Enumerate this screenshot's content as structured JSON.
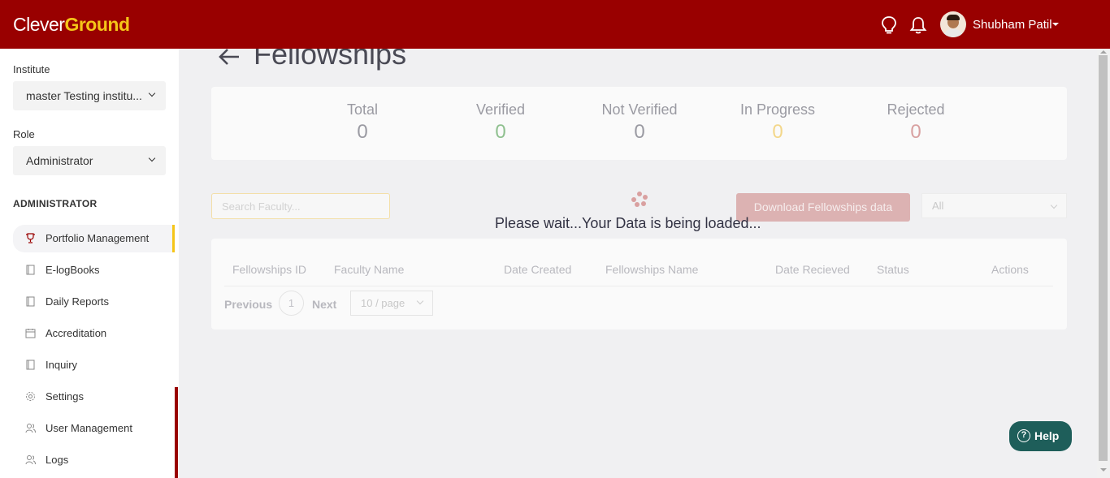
{
  "header": {
    "logo_part1": "Clever",
    "logo_part2": "Ground",
    "user_name": "Shubham Patil",
    "icons": [
      "lightbulb-icon",
      "bell-icon"
    ]
  },
  "sidebar": {
    "institute_label": "Institute",
    "institute_value": "master Testing institu...",
    "role_label": "Role",
    "role_value": "Administrator",
    "section_title": "ADMINISTRATOR",
    "items": [
      {
        "label": "Portfolio Management",
        "icon": "trophy-icon",
        "active": true
      },
      {
        "label": "E-logBooks",
        "icon": "book-icon"
      },
      {
        "label": "Daily Reports",
        "icon": "book-icon"
      },
      {
        "label": "Accreditation",
        "icon": "calendar-icon"
      },
      {
        "label": "Inquiry",
        "icon": "book-icon"
      },
      {
        "label": "Settings",
        "icon": "gear-icon"
      },
      {
        "label": "User Management",
        "icon": "users-icon"
      },
      {
        "label": "Logs",
        "icon": "users-icon"
      }
    ]
  },
  "main": {
    "title": "Fellowships",
    "stats": [
      {
        "label": "Total",
        "value": "0",
        "color": "#9a9aa2"
      },
      {
        "label": "Verified",
        "value": "0",
        "color": "#8fc08f"
      },
      {
        "label": "Not Verified",
        "value": "0",
        "color": "#9a9aa2"
      },
      {
        "label": "In Progress",
        "value": "0",
        "color": "#f3d78a"
      },
      {
        "label": "Rejected",
        "value": "0",
        "color": "#d8a0a0"
      }
    ],
    "search_placeholder": "Search Faculty...",
    "download_label": "Download Fellowships data",
    "filter_value": "All",
    "loading_text": "Please wait...Your Data is being loaded...",
    "columns": [
      "Fellowships ID",
      "Faculty Name",
      "Date Created",
      "Fellowships Name",
      "Date Recieved",
      "Status",
      "Actions"
    ],
    "pagination": {
      "prev": "Previous",
      "page": "1",
      "next": "Next",
      "page_size": "10 / page"
    }
  },
  "help": {
    "label": "Help",
    "q": "?"
  },
  "colors": {
    "brand": "#990000",
    "accent": "#f5c518",
    "help": "#1e5e5a"
  }
}
